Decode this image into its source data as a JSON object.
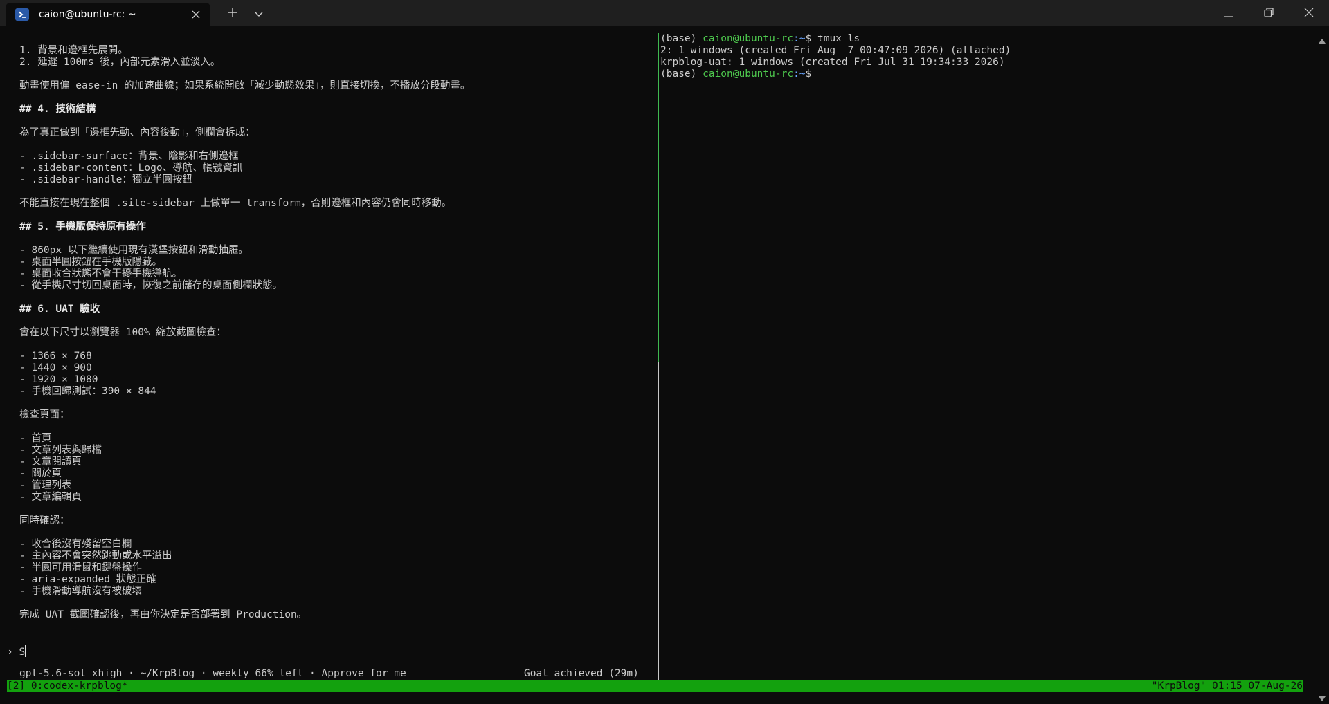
{
  "tab": {
    "title": "caion@ubuntu-rc: ~",
    "icon": "powershell-icon"
  },
  "window_controls": {
    "new_tab_icon": "plus-icon",
    "dropdown_icon": "chevron-down-icon",
    "minimize_icon": "minimize-icon",
    "restore_icon": "restore-icon",
    "close_icon": "close-icon"
  },
  "left_pane": {
    "lines": [
      {
        "text": "1. 背景和邊框先展開。",
        "bold": false
      },
      {
        "text": "2. 延遲 100ms 後，內部元素滑入並淡入。",
        "bold": false
      },
      {
        "text": "",
        "bold": false
      },
      {
        "text": "動畫使用偏 ease-in 的加速曲線；如果系統開啟「減少動態效果」，則直接切換，不播放分段動畫。",
        "bold": false
      },
      {
        "text": "",
        "bold": false
      },
      {
        "text": "## 4. 技術結構",
        "bold": true
      },
      {
        "text": "",
        "bold": false
      },
      {
        "text": "為了真正做到「邊框先動、內容後動」，側欄會拆成：",
        "bold": false
      },
      {
        "text": "",
        "bold": false
      },
      {
        "text": "- .sidebar-surface：背景、陰影和右側邊框",
        "bold": false
      },
      {
        "text": "- .sidebar-content：Logo、導航、帳號資訊",
        "bold": false
      },
      {
        "text": "- .sidebar-handle：獨立半圓按鈕",
        "bold": false
      },
      {
        "text": "",
        "bold": false
      },
      {
        "text": "不能直接在現在整個 .site-sidebar 上做單一 transform，否則邊框和內容仍會同時移動。",
        "bold": false
      },
      {
        "text": "",
        "bold": false
      },
      {
        "text": "## 5. 手機版保持原有操作",
        "bold": true
      },
      {
        "text": "",
        "bold": false
      },
      {
        "text": "- 860px 以下繼續使用現有漢堡按鈕和滑動抽屜。",
        "bold": false
      },
      {
        "text": "- 桌面半圓按鈕在手機版隱藏。",
        "bold": false
      },
      {
        "text": "- 桌面收合狀態不會干擾手機導航。",
        "bold": false
      },
      {
        "text": "- 從手機尺寸切回桌面時，恢復之前儲存的桌面側欄狀態。",
        "bold": false
      },
      {
        "text": "",
        "bold": false
      },
      {
        "text": "## 6. UAT 驗收",
        "bold": true
      },
      {
        "text": "",
        "bold": false
      },
      {
        "text": "會在以下尺寸以瀏覽器 100% 縮放截圖檢查：",
        "bold": false
      },
      {
        "text": "",
        "bold": false
      },
      {
        "text": "- 1366 × 768",
        "bold": false
      },
      {
        "text": "- 1440 × 900",
        "bold": false
      },
      {
        "text": "- 1920 × 1080",
        "bold": false
      },
      {
        "text": "- 手機回歸測試：390 × 844",
        "bold": false
      },
      {
        "text": "",
        "bold": false
      },
      {
        "text": "檢查頁面：",
        "bold": false
      },
      {
        "text": "",
        "bold": false
      },
      {
        "text": "- 首頁",
        "bold": false
      },
      {
        "text": "- 文章列表與歸檔",
        "bold": false
      },
      {
        "text": "- 文章閱讀頁",
        "bold": false
      },
      {
        "text": "- 關於頁",
        "bold": false
      },
      {
        "text": "- 管理列表",
        "bold": false
      },
      {
        "text": "- 文章編輯頁",
        "bold": false
      },
      {
        "text": "",
        "bold": false
      },
      {
        "text": "同時確認：",
        "bold": false
      },
      {
        "text": "",
        "bold": false
      },
      {
        "text": "- 收合後沒有殘留空白欄",
        "bold": false
      },
      {
        "text": "- 主內容不會突然跳動或水平溢出",
        "bold": false
      },
      {
        "text": "- 半圓可用滑鼠和鍵盤操作",
        "bold": false
      },
      {
        "text": "- aria-expanded 狀態正確",
        "bold": false
      },
      {
        "text": "- 手機滑動導航沒有被破壞",
        "bold": false
      },
      {
        "text": "",
        "bold": false
      },
      {
        "text": "完成 UAT 截圖確認後，再由你決定是否部署到 Production。",
        "bold": false
      }
    ],
    "prompt_symbol": "›",
    "input_value": "S",
    "status_left": "gpt-5.6-sol xhigh · ~/KrpBlog · weekly 66% left · Approve for me",
    "status_right": "Goal achieved (29m)"
  },
  "right_pane": {
    "lines": [
      {
        "prefix": "(base) ",
        "user": "caion@ubuntu-rc",
        "path": ":~",
        "rest": "$ tmux ls"
      },
      {
        "prefix": "2: 1 windows (created Fri Aug  7 00:47:09 2026) (attached)",
        "user": "",
        "path": "",
        "rest": ""
      },
      {
        "prefix": "krpblog-uat: 1 windows (created Fri Jul 31 19:34:33 2026)",
        "user": "",
        "path": "",
        "rest": ""
      },
      {
        "prefix": "(base) ",
        "user": "caion@ubuntu-rc",
        "path": ":~",
        "rest": "$"
      }
    ]
  },
  "tmux_bar": {
    "left": "[2] 0:codex-krpblog*",
    "right": "\"KrpBlog\" 01:15 07-Aug-26",
    "color": "#13a10e"
  }
}
